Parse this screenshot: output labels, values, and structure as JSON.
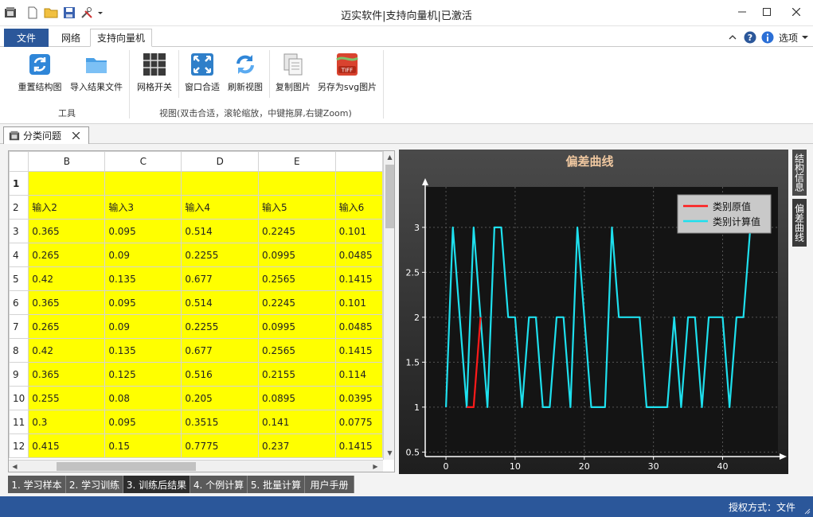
{
  "window": {
    "title": "迈实软件|支持向量机|已激活",
    "controls": [
      "minimize",
      "maximize",
      "close"
    ]
  },
  "ribbon_tabs": {
    "file": "文件",
    "network": "网络",
    "svm": "支持向量机",
    "options": "选项"
  },
  "ribbon": {
    "group_tools": {
      "label": "工具",
      "buttons": [
        {
          "label": "重置结构图",
          "icon": "refresh-icon"
        },
        {
          "label": "导入结果文件",
          "icon": "folder-icon"
        }
      ]
    },
    "group_view": {
      "label": "视图(双击合适，滚轮缩放，中键拖屏,右键Zoom)",
      "buttons": [
        {
          "label": "网格开关",
          "icon": "grid-icon"
        },
        {
          "label": "窗口合适",
          "icon": "fit-window-icon"
        },
        {
          "label": "刷新视图",
          "icon": "refresh-view-icon"
        },
        {
          "label": "复制图片",
          "icon": "copy-image-icon"
        },
        {
          "label": "另存为svg图片",
          "icon": "tiff-save-icon"
        }
      ],
      "tiff_badge": "TIFF"
    }
  },
  "doc_tab": {
    "label": "分类问题"
  },
  "sheet": {
    "columns": [
      "B",
      "C",
      "D",
      "E",
      ""
    ],
    "rows": [
      {
        "n": "1",
        "cells": [
          "",
          "",
          "",
          "",
          ""
        ]
      },
      {
        "n": "2",
        "cells": [
          "输入2",
          "输入3",
          "输入4",
          "输入5",
          "输入6"
        ]
      },
      {
        "n": "3",
        "cells": [
          "0.365",
          "0.095",
          "0.514",
          "0.2245",
          "0.101"
        ]
      },
      {
        "n": "4",
        "cells": [
          "0.265",
          "0.09",
          "0.2255",
          "0.0995",
          "0.0485"
        ]
      },
      {
        "n": "5",
        "cells": [
          "0.42",
          "0.135",
          "0.677",
          "0.2565",
          "0.1415"
        ]
      },
      {
        "n": "6",
        "cells": [
          "0.365",
          "0.095",
          "0.514",
          "0.2245",
          "0.101"
        ]
      },
      {
        "n": "7",
        "cells": [
          "0.265",
          "0.09",
          "0.2255",
          "0.0995",
          "0.0485"
        ]
      },
      {
        "n": "8",
        "cells": [
          "0.42",
          "0.135",
          "0.677",
          "0.2565",
          "0.1415"
        ]
      },
      {
        "n": "9",
        "cells": [
          "0.365",
          "0.125",
          "0.516",
          "0.2155",
          "0.114"
        ]
      },
      {
        "n": "10",
        "cells": [
          "0.255",
          "0.08",
          "0.205",
          "0.0895",
          "0.0395"
        ]
      },
      {
        "n": "11",
        "cells": [
          "0.3",
          "0.095",
          "0.3515",
          "0.141",
          "0.0775"
        ]
      },
      {
        "n": "12",
        "cells": [
          "0.415",
          "0.15",
          "0.7775",
          "0.237",
          "0.1415"
        ]
      }
    ],
    "cell_color": "#ffff00"
  },
  "chart_data": {
    "type": "line",
    "title": "偏差曲线",
    "xlabel": "",
    "ylabel": "",
    "xlim": [
      -3,
      48
    ],
    "ylim": [
      0.45,
      3.45
    ],
    "x_ticks": [
      "0",
      "10",
      "20",
      "30",
      "40"
    ],
    "x_tick_values": [
      0,
      10,
      20,
      30,
      40
    ],
    "y_ticks": [
      "0.5",
      "1",
      "1.5",
      "2",
      "2.5",
      "3"
    ],
    "y_tick_values": [
      0.5,
      1,
      1.5,
      2,
      2.5,
      3
    ],
    "grid": true,
    "legend_position": "top-right",
    "series": [
      {
        "name": "类别原值",
        "color": "#ff1a1a",
        "x": [
          3,
          4,
          5
        ],
        "y": [
          1,
          1,
          2
        ]
      },
      {
        "name": "类别计算值",
        "color": "#1ee0ee",
        "x": [
          0,
          1,
          2,
          3,
          4,
          5,
          6,
          7,
          8,
          9,
          10,
          11,
          12,
          13,
          14,
          15,
          16,
          17,
          18,
          19,
          20,
          21,
          22,
          23,
          24,
          25,
          26,
          27,
          28,
          29,
          30,
          31,
          32,
          33,
          34,
          35,
          36,
          37,
          38,
          39,
          40,
          41,
          42,
          43,
          44,
          45,
          46
        ],
        "y": [
          1,
          3,
          2,
          1,
          3,
          2,
          1,
          3,
          3,
          2,
          2,
          1,
          2,
          2,
          1,
          1,
          2,
          2,
          1,
          3,
          2,
          1,
          1,
          1,
          3,
          2,
          2,
          2,
          2,
          1,
          1,
          1,
          1,
          2,
          1,
          2,
          2,
          1,
          2,
          2,
          2,
          1,
          2,
          2,
          3,
          3,
          3
        ]
      }
    ]
  },
  "side_tabs": [
    "结构信息",
    "偏差曲线"
  ],
  "bottom_tabs": [
    "1. 学习样本",
    "2. 学习训练",
    "3. 训练后结果",
    "4. 个例计算",
    "5. 批量计算",
    "用户手册"
  ],
  "bottom_tab_active": 2,
  "status": {
    "text": "授权方式：文件"
  }
}
